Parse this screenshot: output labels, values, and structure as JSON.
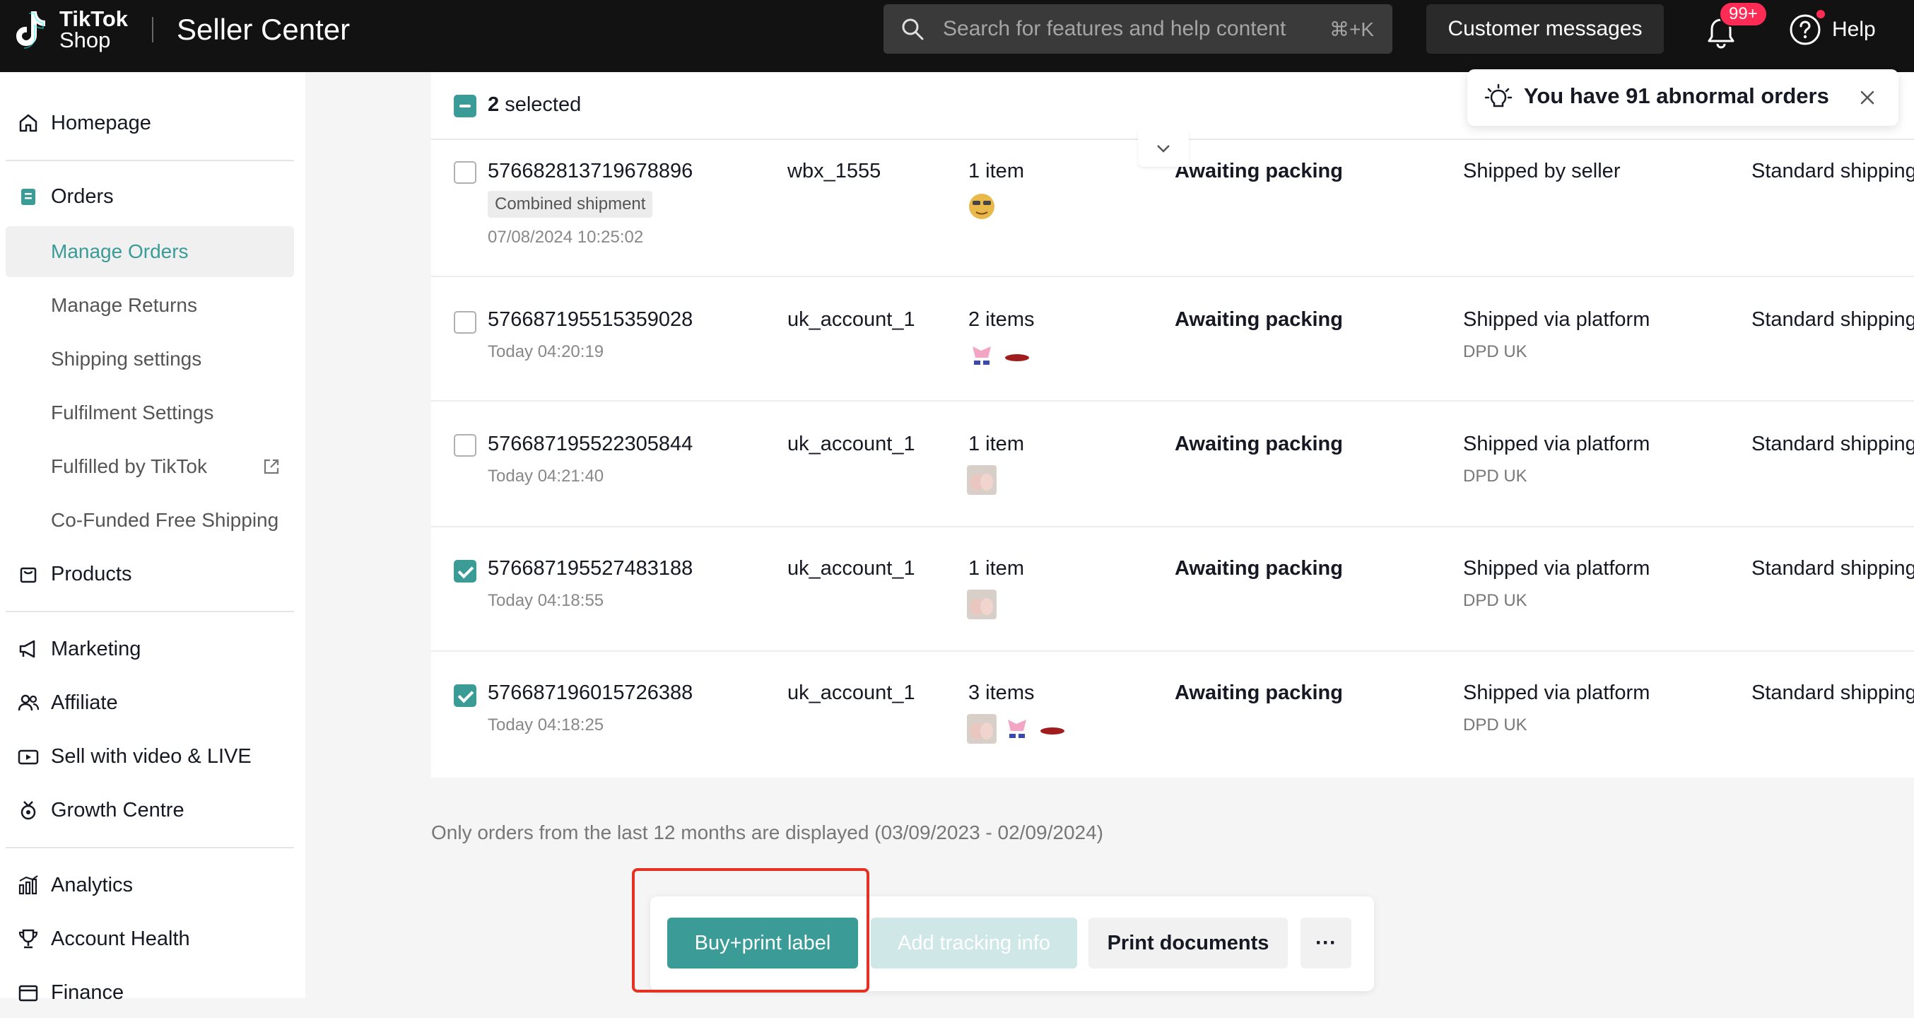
{
  "header": {
    "logo_line1": "TikTok",
    "logo_line2": "Shop",
    "title": "Seller Center",
    "search_placeholder": "Search for features and help content",
    "search_shortcut": "⌘+K",
    "customer_messages": "Customer messages",
    "notification_count": "99+",
    "help": "Help"
  },
  "sidebar": {
    "homepage": "Homepage",
    "orders": "Orders",
    "manage_orders": "Manage Orders",
    "manage_returns": "Manage Returns",
    "shipping_settings": "Shipping settings",
    "fulfilment_settings": "Fulfilment Settings",
    "fulfilled_by_tiktok": "Fulfilled by TikTok",
    "cofunded_shipping": "Co-Funded Free Shipping",
    "products": "Products",
    "marketing": "Marketing",
    "affiliate": "Affiliate",
    "sell_video_live": "Sell with video & LIVE",
    "growth_centre": "Growth Centre",
    "analytics": "Analytics",
    "account_health": "Account Health",
    "finance": "Finance"
  },
  "selection": {
    "count": "2",
    "label": "selected"
  },
  "notice": {
    "text": "You have 91 abnormal orders"
  },
  "orders": [
    {
      "id": "576682813719678896",
      "tag": "Combined shipment",
      "time": "07/08/2024 10:25:02",
      "buyer": "wbx_1555",
      "items": "1 item",
      "status": "Awaiting packing",
      "shipping": "Shipped by seller",
      "carrier": "",
      "method": "Standard shipping",
      "checked": false
    },
    {
      "id": "576687195515359028",
      "tag": "",
      "time": "Today 04:20:19",
      "buyer": "uk_account_1",
      "items": "2 items",
      "status": "Awaiting packing",
      "shipping": "Shipped via platform",
      "carrier": "DPD UK",
      "method": "Standard shipping",
      "checked": false
    },
    {
      "id": "576687195522305844",
      "tag": "",
      "time": "Today 04:21:40",
      "buyer": "uk_account_1",
      "items": "1 item",
      "status": "Awaiting packing",
      "shipping": "Shipped via platform",
      "carrier": "DPD UK",
      "method": "Standard shipping",
      "checked": false
    },
    {
      "id": "576687195527483188",
      "tag": "",
      "time": "Today 04:18:55",
      "buyer": "uk_account_1",
      "items": "1 item",
      "status": "Awaiting packing",
      "shipping": "Shipped via platform",
      "carrier": "DPD UK",
      "method": "Standard shipping",
      "checked": true
    },
    {
      "id": "576687196015726388",
      "tag": "",
      "time": "Today 04:18:25",
      "buyer": "uk_account_1",
      "items": "3 items",
      "status": "Awaiting packing",
      "shipping": "Shipped via platform",
      "carrier": "DPD UK",
      "method": "Standard shipping",
      "checked": true
    }
  ],
  "footnote": "Only orders from the last 12 months are displayed (03/09/2023 - 02/09/2024)",
  "actions": {
    "buy_print_label": "Buy+print label",
    "add_tracking": "Add tracking info",
    "print_documents": "Print documents",
    "more": "···"
  },
  "colors": {
    "accent": "#3a9b97",
    "topbar": "#121212",
    "badge": "#fe2c55",
    "highlight": "#e53222"
  }
}
